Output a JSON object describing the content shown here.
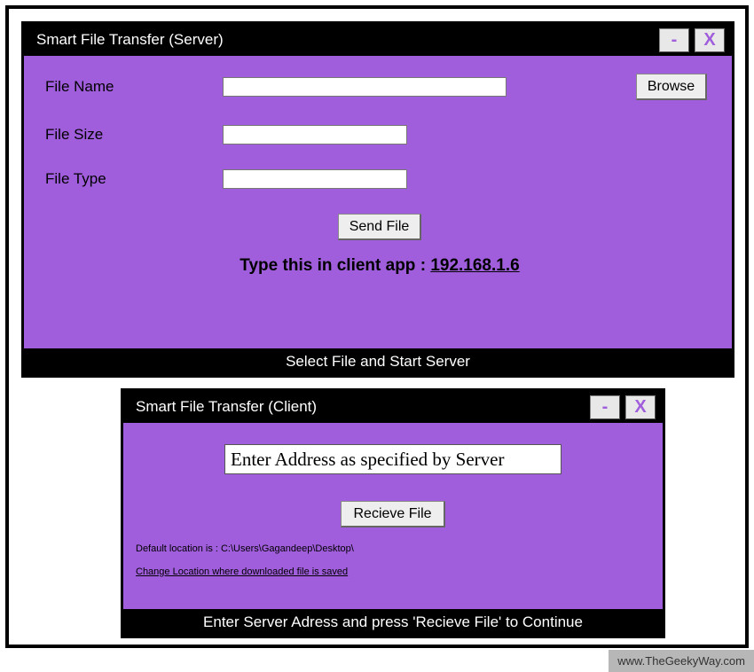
{
  "server": {
    "title": "Smart File Transfer (Server)",
    "minimize": "-",
    "close": "X",
    "labels": {
      "file_name": "File Name",
      "file_size": "File Size",
      "file_type": "File Type"
    },
    "values": {
      "file_name": "",
      "file_size": "",
      "file_type": ""
    },
    "browse_label": "Browse",
    "send_label": "Send File",
    "ip_prefix": "Type this in client app : ",
    "ip_address": "192.168.1.6",
    "status": "Select File and Start Server"
  },
  "client": {
    "title": "Smart File Transfer (Client)",
    "minimize": "-",
    "close": "X",
    "address_value": "Enter Address as specified by Server",
    "receive_label": "Recieve File",
    "default_location": "Default location is : C:\\Users\\Gagandeep\\Desktop\\",
    "change_location": "Change Location where downloaded file is saved ",
    "status": "Enter Server Adress and press 'Recieve File' to Continue"
  },
  "watermark": "www.TheGeekyWay.com"
}
